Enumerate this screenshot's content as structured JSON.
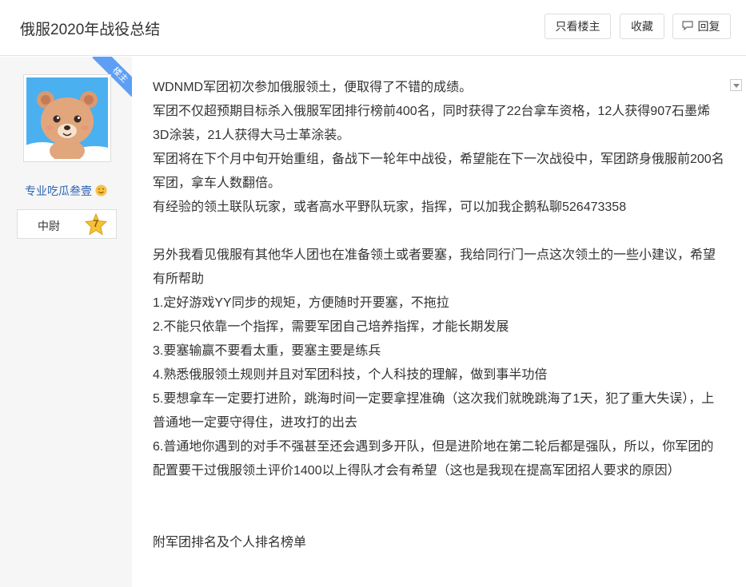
{
  "header": {
    "title": "俄服2020年战役总结",
    "buttons": {
      "only_op": "只看楼主",
      "favorite": "收藏",
      "reply": "回复"
    }
  },
  "author": {
    "corner_badge": "楼主",
    "username": "专业吃瓜叁壹",
    "rank_title": "中尉",
    "rank_level": "7",
    "avatar_icon": "bear-avatar-icon"
  },
  "post": {
    "p1": "WDNMD军团初次参加俄服领土，便取得了不错的成绩。",
    "p2": "军团不仅超预期目标杀入俄服军团排行榜前400名，同时获得了22台拿车资格，12人获得907石墨烯3D涂装，21人获得大马士革涂装。",
    "p3": "军团将在下个月中旬开始重组，备战下一轮年中战役，希望能在下一次战役中，军团跻身俄服前200名军团，拿车人数翻倍。",
    "p4": "有经验的领土联队玩家，或者高水平野队玩家，指挥，可以加我企鹅私聊526473358",
    "p5": "另外我看见俄服有其他华人团也在准备领土或者要塞，我给同行门一点这次领土的一些小建议，希望有所帮助",
    "tips": [
      "1.定好游戏YY同步的规矩，方便随时开要塞，不拖拉",
      "2.不能只依靠一个指挥，需要军团自己培养指挥，才能长期发展",
      "3.要塞输赢不要看太重，要塞主要是练兵",
      "4.熟悉俄服领土规则并且对军团科技，个人科技的理解，做到事半功倍",
      "5.要想拿车一定要打进阶，跳海时间一定要拿捏准确（这次我们就晚跳海了1天，犯了重大失误），上普通地一定要守得住，进攻打的出去",
      "6.普通地你遇到的对手不强甚至还会遇到多开队，但是进阶地在第二轮后都是强队，所以，你军团的配置要干过俄服领土评价1400以上得队才会有希望（这也是我现在提高军团招人要求的原因）"
    ],
    "p_last": "附军团排名及个人排名榜单"
  },
  "colors": {
    "accent_blue": "#5e9ef4",
    "username_blue": "#2d64b3",
    "sidebar_bg": "#f6f6f6"
  }
}
